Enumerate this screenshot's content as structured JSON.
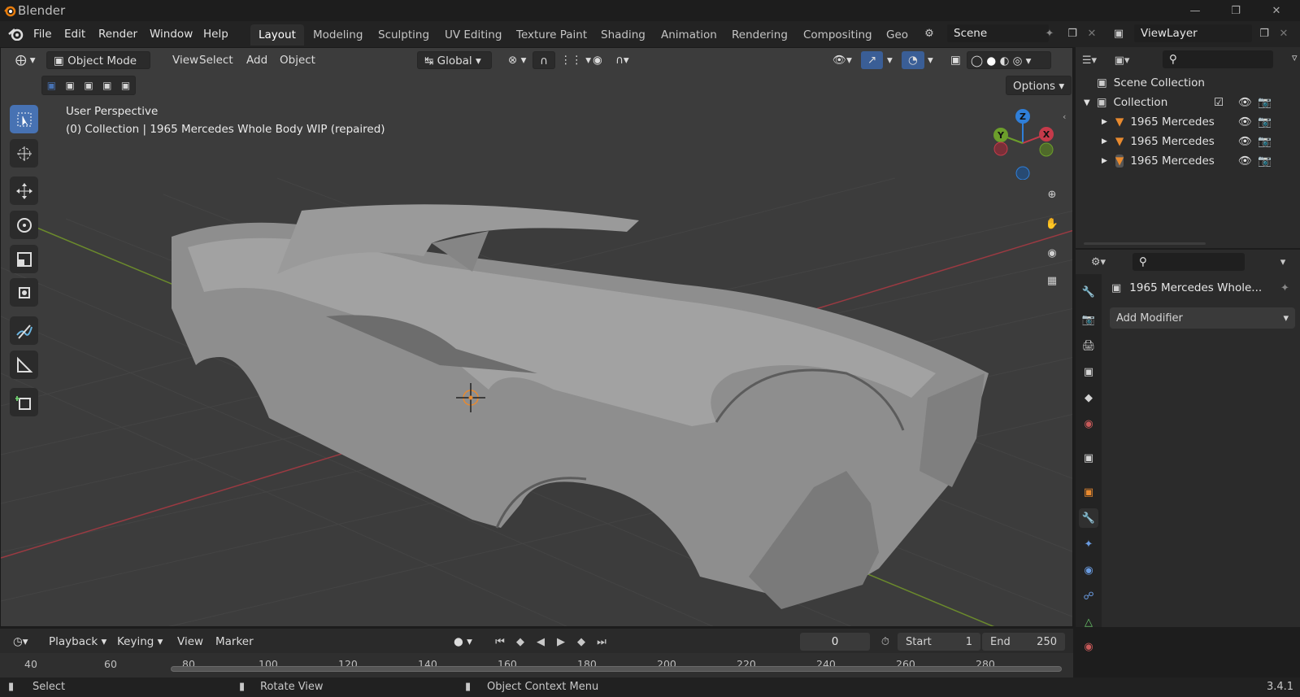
{
  "window": {
    "title": "Blender",
    "version": "3.4.1"
  },
  "menu": [
    "File",
    "Edit",
    "Render",
    "Window",
    "Help"
  ],
  "workspaces": [
    "Layout",
    "Modeling",
    "Sculpting",
    "UV Editing",
    "Texture Paint",
    "Shading",
    "Animation",
    "Rendering",
    "Compositing",
    "Geo"
  ],
  "scene": {
    "name": "Scene",
    "view_layer": "ViewLayer"
  },
  "viewport": {
    "mode": "Object Mode",
    "menus": [
      "View",
      "Select",
      "Add",
      "Object"
    ],
    "orientation": "Global",
    "options_label": "Options",
    "overlay_title": "User Perspective",
    "overlay_subtitle": "(0) Collection | 1965 Mercedes Whole Body WIP (repaired)",
    "gizmo": {
      "z": "Z",
      "y": "Y",
      "x": "X"
    }
  },
  "outliner": {
    "scene_collection": "Scene Collection",
    "collection": "Collection",
    "items": [
      "1965 Mercedes",
      "1965 Mercedes",
      "1965 Mercedes"
    ]
  },
  "properties": {
    "object_name": "1965 Mercedes Whole...",
    "add_modifier": "Add Modifier"
  },
  "timeline": {
    "menus": [
      "Playback",
      "Keying",
      "View",
      "Marker"
    ],
    "current_frame": "0",
    "start_label": "Start",
    "start": "1",
    "end_label": "End",
    "end": "250",
    "ticks": [
      "40",
      "60",
      "80",
      "100",
      "120",
      "140",
      "160",
      "180",
      "200",
      "220",
      "240",
      "260",
      "280"
    ]
  },
  "status": {
    "select": "Select",
    "rotate": "Rotate View",
    "context": "Object Context Menu"
  },
  "colors": {
    "accent": "#4772b3",
    "x_axis": "#c53a4a",
    "y_axis": "#6c9e2b",
    "z_axis": "#2f7fd9",
    "object": "#e88a2f"
  }
}
